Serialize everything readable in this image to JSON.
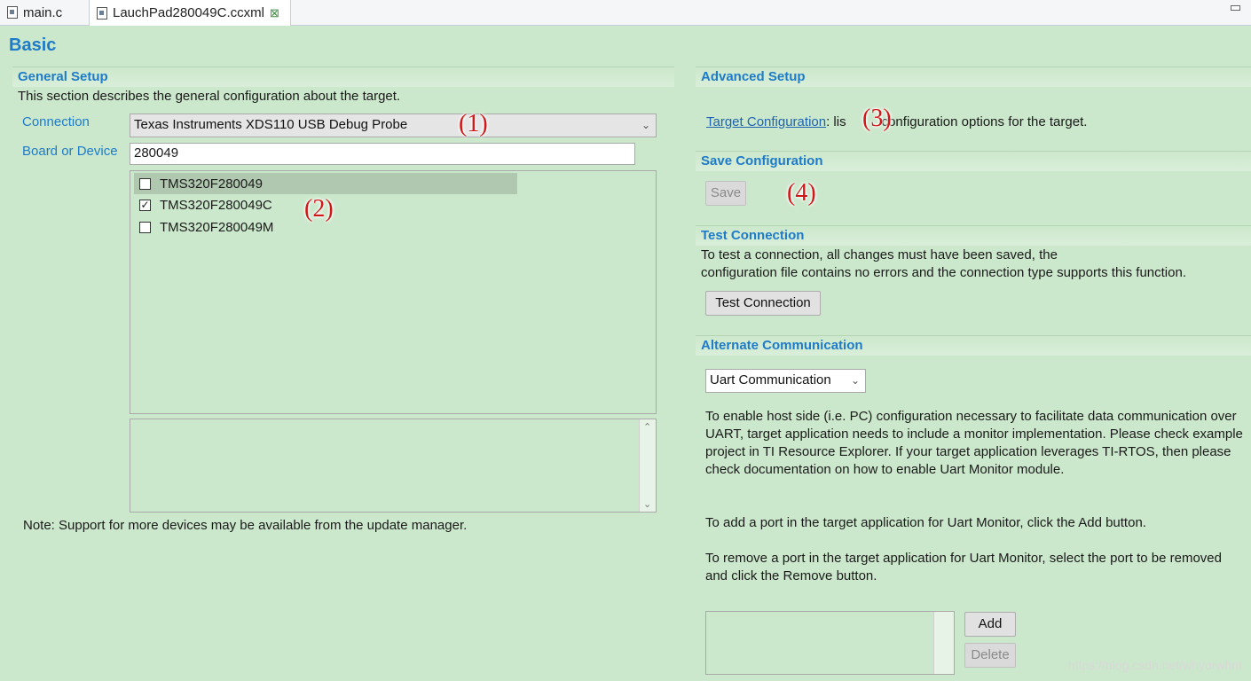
{
  "tabs": [
    {
      "label": "main.c",
      "active": false
    },
    {
      "label": "LauchPad280049C.ccxml",
      "active": true
    }
  ],
  "page_title": "Basic",
  "general_setup": {
    "title": "General Setup",
    "description": "This section describes the general configuration about the target.",
    "connection_label": "Connection",
    "connection_value": "Texas Instruments XDS110 USB Debug Probe",
    "board_label": "Board or Device",
    "board_value": "280049",
    "devices": [
      {
        "name": "TMS320F280049",
        "checked": false
      },
      {
        "name": "TMS320F280049C",
        "checked": true
      },
      {
        "name": "TMS320F280049M",
        "checked": false
      }
    ],
    "note": "Note: Support for more devices may be available from the update manager."
  },
  "advanced_setup": {
    "title": "Advanced Setup",
    "link": "Target Configuration",
    "link_suffix_a": ": lis",
    "link_suffix_b": "configuration options for the target."
  },
  "save_configuration": {
    "title": "Save Configuration",
    "save_label": "Save"
  },
  "test_connection": {
    "title": "Test Connection",
    "line1": "To test a connection, all changes must have been saved, the",
    "line2": "configuration file contains no errors and the connection type supports this function.",
    "button": "Test Connection"
  },
  "alternate_communication": {
    "title": "Alternate Communication",
    "select_value": "Uart Communication",
    "para1": "To enable host side (i.e. PC) configuration necessary to facilitate data communication over UART, target application needs to include a monitor implementation. Please check example project in TI Resource Explorer. If your target application leverages TI-RTOS, then please check documentation on how to enable Uart Monitor module.",
    "para2": "To add a port in the target application for Uart Monitor, click the Add button.",
    "para3": "To remove a port in the target application for Uart Monitor, select the port to be removed and click the Remove button.",
    "add_label": "Add",
    "delete_label": "Delete"
  },
  "markers": [
    "(1)",
    "(2)",
    "(3)",
    "(4)"
  ],
  "watermark": "https://blog.csdn.net/whyorwhnt",
  "colors": {
    "background": "#cce8cc",
    "heading": "#1e7bc9",
    "marker": "#d01818"
  }
}
